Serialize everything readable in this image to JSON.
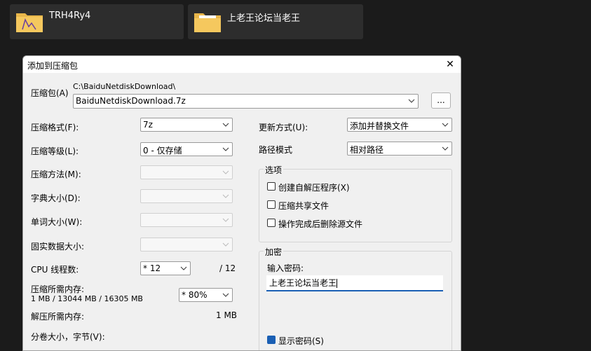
{
  "desktop": {
    "folders": [
      {
        "label": "TRH4Ry4"
      },
      {
        "label": "上老王论坛当老王"
      }
    ]
  },
  "dialog": {
    "title": "添加到压缩包",
    "archive": {
      "label": "压缩包(A)",
      "path": "C:\\BaiduNetdiskDownload\\",
      "filename": "BaiduNetdiskDownload.7z",
      "browse_label": "..."
    },
    "left": {
      "format_label": "压缩格式(F):",
      "format_value": "7z",
      "level_label": "压缩等级(L):",
      "level_value": "0 - 仅存储",
      "method_label": "压缩方法(M):",
      "dict_label": "字典大小(D):",
      "word_label": "单词大小(W):",
      "solid_label": "固实数据大小:",
      "cpu_label": "CPU 线程数:",
      "cpu_value": "* 12",
      "cpu_max": "/ 12",
      "mem_comp_label": "压缩所需内存:",
      "mem_comp_detail": "1 MB / 13044 MB / 16305 MB",
      "mem_comp_value": "* 80%",
      "mem_decomp_label": "解压所需内存:",
      "mem_decomp_value": "1 MB",
      "volume_label": "分卷大小，字节(V):"
    },
    "right": {
      "update_label": "更新方式(U):",
      "update_value": "添加并替换文件",
      "path_label": "路径模式",
      "path_value": "相对路径",
      "options_title": "选项",
      "opt_sfx": "创建自解压程序(X)",
      "opt_shared": "压缩共享文件",
      "opt_delete": "操作完成后删除源文件",
      "enc_title": "加密",
      "pwd_label": "输入密码:",
      "pwd_value": "上老王论坛当老王",
      "show_pwd": "显示密码(S)"
    },
    "colors": {
      "accent": "#1a5fb4"
    }
  }
}
